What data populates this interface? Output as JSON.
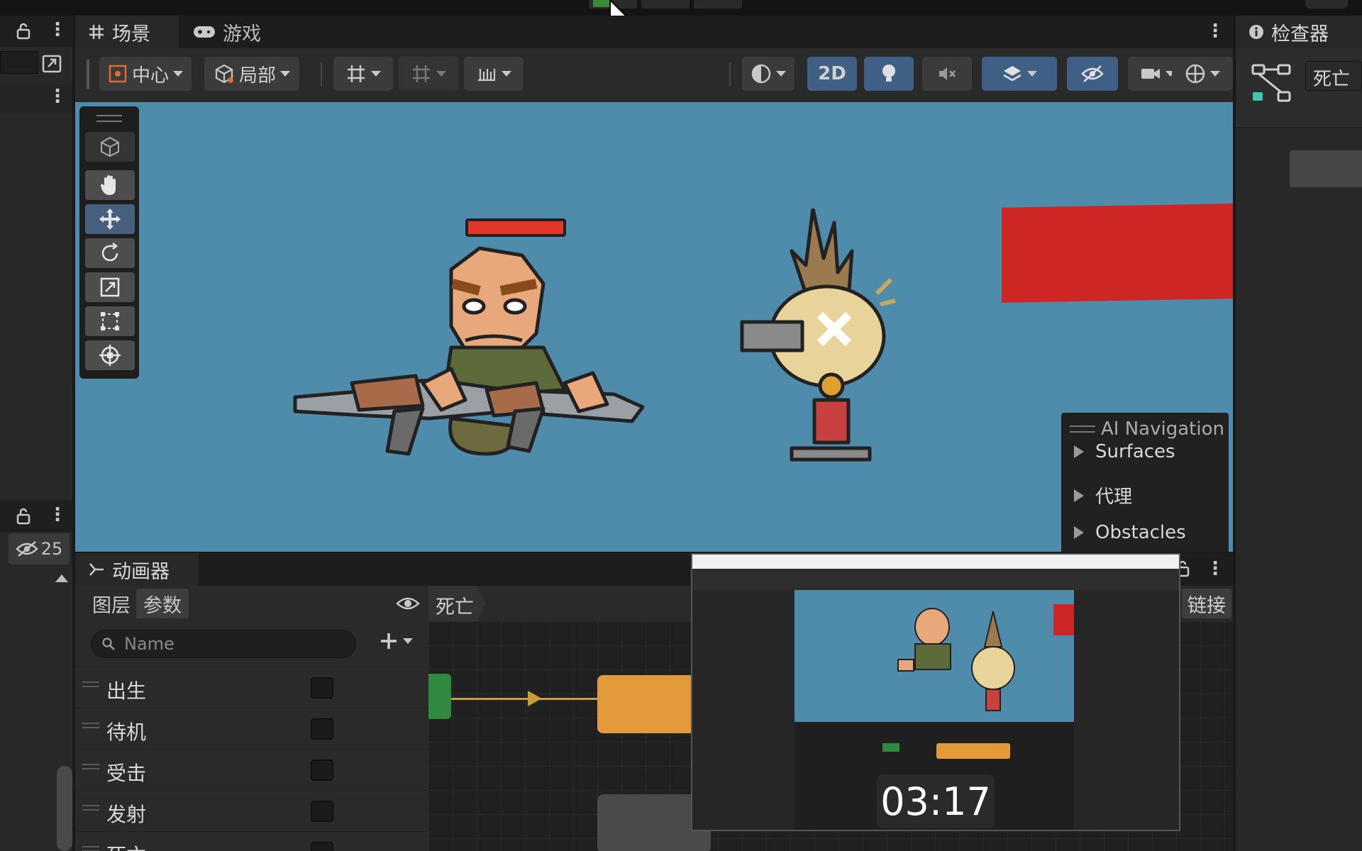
{
  "window": {
    "scene_tab": "场景",
    "game_tab": "游戏",
    "inspector_tab": "检查器",
    "animator_tab": "动画器"
  },
  "left_panel": {
    "hidden_count": "25"
  },
  "scene_toolbar": {
    "pivot_label": "中心",
    "space_label": "局部",
    "mode_2d": "2D"
  },
  "ai_navigation": {
    "title": "AI Navigation",
    "items": [
      "Surfaces",
      "代理",
      "Obstacles"
    ]
  },
  "inspector": {
    "object_name": "死亡"
  },
  "animator": {
    "sub_tabs": [
      "图层",
      "参数"
    ],
    "breadcrumb": "死亡",
    "search_placeholder": "Name",
    "right_label": "链接",
    "parameters": [
      {
        "name": "出生",
        "checked": false
      },
      {
        "name": "待机",
        "checked": false
      },
      {
        "name": "受击",
        "checked": false
      },
      {
        "name": "发射",
        "checked": false
      },
      {
        "name": "死亡",
        "checked": false
      }
    ]
  },
  "video_overlay": {
    "timestamp": "03:17"
  },
  "colors": {
    "viewport_bg": "#4f8bab",
    "accent_blue": "#3f5f85",
    "state_orange": "#e39a3a",
    "entry_green": "#2f8a3f",
    "health_red": "#e1372c"
  }
}
